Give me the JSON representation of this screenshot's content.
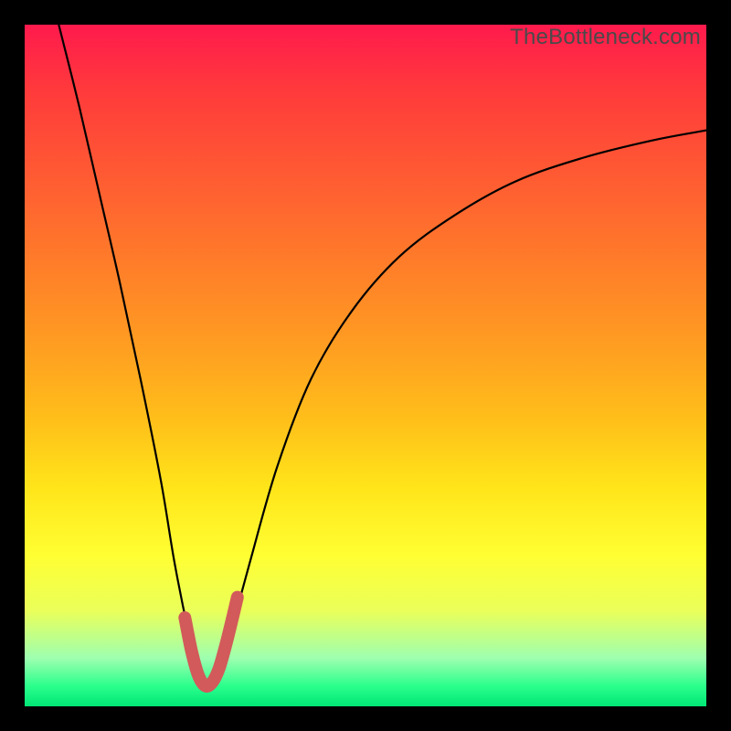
{
  "watermark": "TheBottleneck.com",
  "chart_data": {
    "type": "line",
    "title": "",
    "xlabel": "",
    "ylabel": "",
    "xlim": [
      0,
      100
    ],
    "ylim": [
      0,
      100
    ],
    "grid": false,
    "legend": false,
    "series": [
      {
        "name": "bottleneck-curve",
        "color": "#000000",
        "x": [
          5,
          8,
          11,
          14,
          17,
          20,
          22,
          24,
          25.5,
          27,
          28.5,
          30,
          33,
          37,
          42,
          48,
          55,
          63,
          72,
          82,
          92,
          100
        ],
        "y": [
          100,
          88,
          75,
          62,
          48,
          33,
          21,
          11,
          5,
          3,
          5,
          10,
          21,
          35,
          48,
          58,
          66,
          72,
          77,
          80.5,
          83,
          84.5
        ]
      },
      {
        "name": "optimal-region-highlight",
        "color": "#d25a5a",
        "x": [
          23.5,
          24.5,
          25.5,
          26.5,
          27.5,
          28.5,
          29.5,
          30.5,
          31.2
        ],
        "y": [
          13,
          8,
          4.5,
          3,
          3.5,
          5.5,
          9,
          13,
          16
        ]
      }
    ],
    "annotations": []
  }
}
